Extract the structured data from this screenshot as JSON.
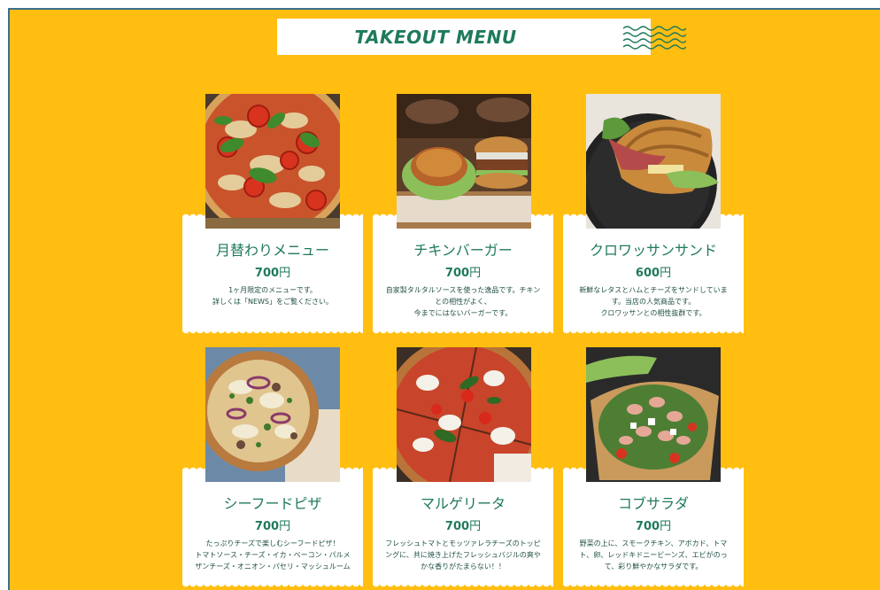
{
  "header": {
    "title": "TAKEOUT MENU",
    "icon": "wave-lines-icon"
  },
  "colors": {
    "background": "#FFBE10",
    "accent": "#1f7a5c",
    "card": "#ffffff",
    "frame_border": "#3d6f8f"
  },
  "menu": {
    "items": [
      {
        "name": "月替わりメニュー",
        "price": "700",
        "currency": "円",
        "description": "1ヶ月限定のメニューです。\n詳しくは「NEWS」をご覧ください。",
        "photo": "margherita-pizza-photo"
      },
      {
        "name": "チキンバーガー",
        "price": "700",
        "currency": "円",
        "description": "自家製タルタルソースを使った逸品です。チキン\nとの相性がよく、\n今までにはないバーガーです。",
        "photo": "chicken-burger-photo"
      },
      {
        "name": "クロワッサンサンド",
        "price": "600",
        "currency": "円",
        "description": "新鮮なレタスとハムとチーズをサンドしていま\nす。当店の人気商品です。\nクロワッサンとの相性抜群です。",
        "photo": "croissant-sandwich-photo"
      },
      {
        "name": "シーフードピザ",
        "price": "700",
        "currency": "円",
        "description": "たっぷりチーズで楽しむシーフードピザ！\nトマトソース・チーズ・イカ・ベーコン・パルメ\nザンチーズ・オニオン・パセリ・マッシュルーム",
        "photo": "seafood-pizza-photo"
      },
      {
        "name": "マルゲリータ",
        "price": "700",
        "currency": "円",
        "description": "フレッシュトマトとモッツァレラチーズのトッピ\nングに、共に焼き上げたフレッシュバジルの爽や\nかな香りがたまらない！！",
        "photo": "margherita-photo"
      },
      {
        "name": "コブサラダ",
        "price": "700",
        "currency": "円",
        "description": "野菜の上に、スモークチキン、アボカド、トマ\nト、卵、レッドキドニービーンズ、エビがのっ\nて、彩り鮮やかなサラダです。",
        "photo": "cobb-salad-photo"
      }
    ]
  }
}
